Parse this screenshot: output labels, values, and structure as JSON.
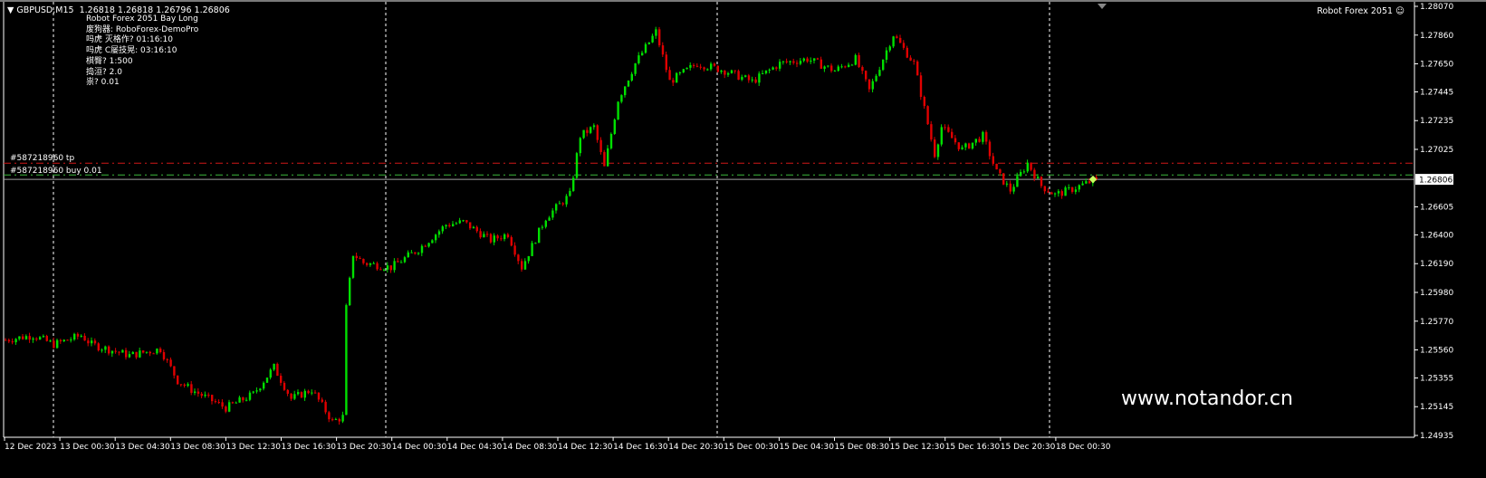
{
  "header": {
    "symbol": "GBPUSD,M15",
    "ohlc": "1.26818 1.26818 1.26796 1.26806"
  },
  "ea_info": {
    "lines": [
      "Robot Forex 2051 Bay Long",
      "废狗器: RoboForex-DemoPro",
      "吗虎    灭格作? 01:16:10",
      "吗虎    C屡技晃: 03:16:10",
      "棋臀? 1:500",
      "捣洹? 2.0",
      "祟?    0.01"
    ]
  },
  "ea_name": "Robot Forex 2051",
  "ea_icon": "smiley-icon",
  "watermark": "www.notandor.cn",
  "orders": {
    "tp_label": "#587218960 tp",
    "buy_label": "#587218960 buy 0.01",
    "tp_price": 1.26924,
    "buy_price": 1.26838
  },
  "colors": {
    "bull": "#00e000",
    "bear": "#e00000",
    "tp": "#d01818",
    "buy": "#3cb83c",
    "current": "#a0a0a0"
  },
  "chart_data": {
    "type": "candlestick",
    "title": "GBPUSD,M15",
    "current_price": "1.26806",
    "ylim": [
      1.24935,
      1.2807
    ],
    "y_ticks": [
      "1.28070",
      "1.27860",
      "1.27650",
      "1.27445",
      "1.27235",
      "1.27025",
      "1.26605",
      "1.26400",
      "1.26190",
      "1.25980",
      "1.25770",
      "1.25560",
      "1.25355",
      "1.25145",
      "1.24935"
    ],
    "x_ticks": [
      "12 Dec 2023",
      "13 Dec 00:30",
      "13 Dec 04:30",
      "13 Dec 08:30",
      "13 Dec 12:30",
      "13 Dec 16:30",
      "13 Dec 20:30",
      "14 Dec 00:30",
      "14 Dec 04:30",
      "14 Dec 08:30",
      "14 Dec 12:30",
      "14 Dec 16:30",
      "14 Dec 20:30",
      "15 Dec 00:30",
      "15 Dec 04:30",
      "15 Dec 08:30",
      "15 Dec 12:30",
      "15 Dec 16:30",
      "15 Dec 20:30",
      "18 Dec 00:30"
    ],
    "candle_count": 318,
    "close_path": [
      [
        0,
        1.25633
      ],
      [
        8,
        1.25666
      ],
      [
        14,
        1.256
      ],
      [
        22,
        1.25666
      ],
      [
        25,
        1.256
      ],
      [
        36,
        1.2552
      ],
      [
        45,
        1.25567
      ],
      [
        50,
        1.25335
      ],
      [
        54,
        1.25269
      ],
      [
        64,
        1.25136
      ],
      [
        72,
        1.25236
      ],
      [
        78,
        1.25434
      ],
      [
        83,
        1.25203
      ],
      [
        89,
        1.25269
      ],
      [
        95,
        1.25037
      ],
      [
        98,
        1.2507
      ],
      [
        99,
        1.25865
      ],
      [
        101,
        1.26262
      ],
      [
        104,
        1.26196
      ],
      [
        112,
        1.26163
      ],
      [
        120,
        1.26295
      ],
      [
        128,
        1.26474
      ],
      [
        133,
        1.26494
      ],
      [
        141,
        1.26362
      ],
      [
        146,
        1.26408
      ],
      [
        150,
        1.26163
      ],
      [
        157,
        1.26527
      ],
      [
        164,
        1.26693
      ],
      [
        167,
        1.27123
      ],
      [
        171,
        1.27189
      ],
      [
        174,
        1.26891
      ],
      [
        178,
        1.27388
      ],
      [
        183,
        1.27653
      ],
      [
        189,
        1.27885
      ],
      [
        193,
        1.2752
      ],
      [
        201,
        1.27653
      ],
      [
        209,
        1.276
      ],
      [
        217,
        1.2752
      ],
      [
        225,
        1.27653
      ],
      [
        233,
        1.27686
      ],
      [
        241,
        1.276
      ],
      [
        247,
        1.27686
      ],
      [
        251,
        1.27454
      ],
      [
        258,
        1.27865
      ],
      [
        264,
        1.27653
      ],
      [
        270,
        1.26991
      ],
      [
        272,
        1.27189
      ],
      [
        278,
        1.27024
      ],
      [
        284,
        1.27123
      ],
      [
        288,
        1.26858
      ],
      [
        292,
        1.26726
      ],
      [
        297,
        1.26925
      ],
      [
        301,
        1.26759
      ],
      [
        305,
        1.26693
      ],
      [
        309,
        1.26726
      ],
      [
        317,
        1.26806
      ]
    ]
  }
}
